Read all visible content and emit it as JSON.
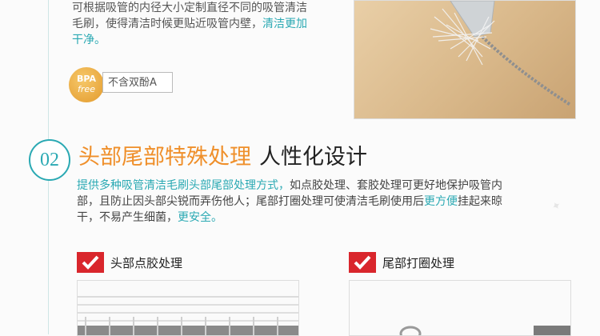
{
  "intro": {
    "line1": "可根据吸管的内径大小定制直径不同的吸管清洁",
    "line2": "毛刷，使得清洁时候更贴近吸管内壁，",
    "line2_highlight": "清洁更加",
    "line3_highlight": "干净。"
  },
  "badge": {
    "top": "BPA",
    "bottom": "free",
    "label": "不含双酚A"
  },
  "section": {
    "number": "02",
    "title_main": "头部尾部特殊处理",
    "title_sub": "人性化设计",
    "desc_highlight1": "提供多种吸管清洁毛刷头部尾部处理方式，",
    "desc_part1": "如点胶处理、套胶处理可更好地保护吸管内",
    "desc_part2": "部，且防止因头部尖锐而弄伤他人；尾部打圈处理可使清洁毛刷使用后",
    "desc_highlight2": "更方便",
    "desc_part3": "挂起来晾",
    "desc_part4": "干，不易产生细菌，",
    "desc_highlight3": "更安全。"
  },
  "features": [
    {
      "label": "头部点胶处理"
    },
    {
      "label": "尾部打圈处理"
    }
  ],
  "colors": {
    "accent_teal": "#2aa9b3",
    "accent_orange": "#ef8f2a",
    "check_red": "#d9262c"
  }
}
